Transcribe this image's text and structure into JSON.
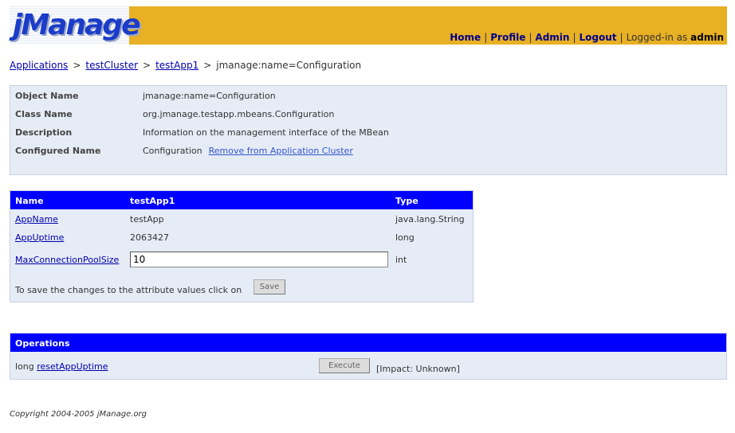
{
  "header": {
    "logo_text": "jManage",
    "nav": [
      {
        "label": "Home"
      },
      {
        "label": "Profile"
      },
      {
        "label": "Admin"
      },
      {
        "label": "Logout"
      }
    ],
    "logged_in_prefix": "Logged-in as",
    "username": "admin"
  },
  "breadcrumb": {
    "items": [
      "Applications",
      "testCluster",
      "testApp1"
    ],
    "current": "jmanage:name=Configuration",
    "separator": ">"
  },
  "info": {
    "object_name_label": "Object Name",
    "object_name_value": "jmanage:name=Configuration",
    "class_name_label": "Class Name",
    "class_name_value": "org.jmanage.testapp.mbeans.Configuration",
    "description_label": "Description",
    "description_value": "Information on the management interface of the MBean",
    "configured_name_label": "Configured Name",
    "configured_name_value": "Configuration",
    "remove_link": "Remove from Application Cluster"
  },
  "attributes": {
    "headers": {
      "name": "Name",
      "app": "testApp1",
      "type": "Type"
    },
    "rows": [
      {
        "name": "AppName",
        "value": "testApp",
        "type": "java.lang.String"
      },
      {
        "name": "AppUptime",
        "value": "2063427",
        "type": "long"
      },
      {
        "name": "MaxConnectionPoolSize",
        "value": "10",
        "type": "int"
      }
    ],
    "save_text": "To save the changes to the attribute values click on",
    "save_button": "Save"
  },
  "operations": {
    "header": "Operations",
    "return_type": "long",
    "name": "resetAppUptime",
    "execute_button": "Execute",
    "impact": "[Impact: Unknown]"
  },
  "footer": {
    "copyright": "Copyright 2004-2005 jManage.org"
  },
  "colors": {
    "header_bg": "#e8b024",
    "table_header_bg": "#0000ff",
    "panel_bg": "#e6ecf6",
    "link": "#0000aa",
    "logo_blue": "#1a3cc8"
  }
}
